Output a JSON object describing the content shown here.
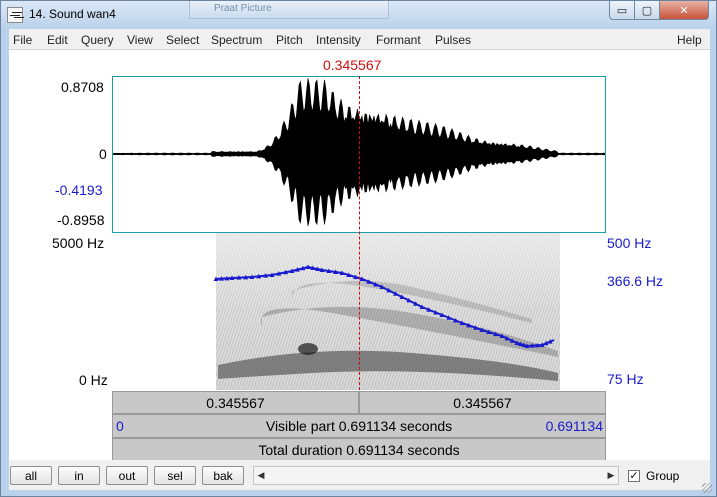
{
  "window": {
    "title": "14. Sound wan4",
    "background_tab": "Praat Picture",
    "minimize_glyph": "▭",
    "maximize_glyph": "▢",
    "close_glyph": "✕"
  },
  "menu": {
    "items": [
      "File",
      "Edit",
      "Query",
      "View",
      "Select",
      "Spectrum",
      "Pitch",
      "Intensity",
      "Formant",
      "Pulses"
    ],
    "help": "Help"
  },
  "cursor": {
    "time_label": "0.345567",
    "color": "#d01010"
  },
  "waveform": {
    "y_max_label": "0.8708",
    "y_zero_label": "0",
    "y_cursor_value_label": "-0.4193",
    "y_min_label": "-0.8958",
    "border_color": "#1a9ea8"
  },
  "spectrogram": {
    "freq_top_label": "5000 Hz",
    "freq_bottom_label": "0 Hz"
  },
  "pitch": {
    "top_label": "500 Hz",
    "cursor_label": "366.6 Hz",
    "bottom_label": "75 Hz",
    "color": "#1a1acd"
  },
  "selection_bar": {
    "left_value": "0.345567",
    "right_value": "0.345567"
  },
  "visible_bar": {
    "start": "0",
    "label": "Visible part 0.691134 seconds",
    "end": "0.691134"
  },
  "total_bar": {
    "label": "Total duration 0.691134 seconds"
  },
  "buttons": {
    "all": "all",
    "in": "in",
    "out": "out",
    "sel": "sel",
    "bak": "bak"
  },
  "scrollbar": {
    "left_arrow": "◀",
    "right_arrow": "▶"
  },
  "group": {
    "label": "Group",
    "checked": true,
    "check_glyph": "✓"
  }
}
